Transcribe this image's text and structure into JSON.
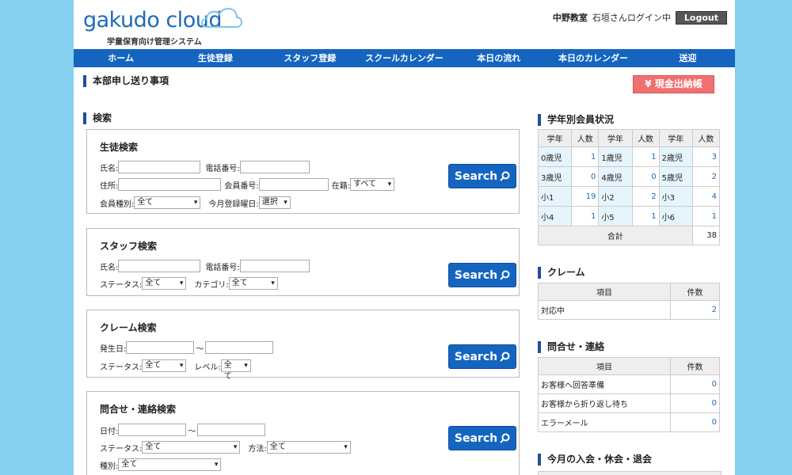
{
  "header": {
    "logo_text": "gakudo cloud",
    "logo_sub": "学童保育向け管理システム",
    "classroom": "中野教室",
    "login_info": "石垣さんログイン中",
    "logout_label": "Logout"
  },
  "nav": [
    "ホーム",
    "生徒登録",
    "スタッフ登録",
    "スクールカレンダー",
    "本日の流れ",
    "本日のカレンダー",
    "送迎"
  ],
  "notice_title": "本部申し送り事項",
  "cash_button": "¥ 現金出納帳",
  "search_title": "検索",
  "search_button": "Search",
  "student_search": {
    "title": "生徒検索",
    "name": "氏名:",
    "phone": "電話番号:",
    "address": "住所:",
    "member_no": "会員番号:",
    "enrolled": "在籍:",
    "enrolled_value": "すべて",
    "member_type": "会員種別:",
    "member_type_value": "全て",
    "reg_day": "今月登録曜日:",
    "reg_day_value": "選択"
  },
  "staff_search": {
    "title": "スタッフ検索",
    "name": "氏名:",
    "phone": "電話番号:",
    "status": "ステータス:",
    "status_value": "全て",
    "category": "カテゴリ:",
    "category_value": "全て"
  },
  "claim_search": {
    "title": "クレーム検索",
    "date": "発生日:",
    "tilde": "～",
    "status": "ステータス:",
    "status_value": "全て",
    "level": "レベル:",
    "level_value": "全て"
  },
  "inquiry_search": {
    "title": "問合せ・連絡検索",
    "date": "日付:",
    "tilde": "～",
    "status": "ステータス:",
    "status_value": "全て",
    "method": "方法:",
    "method_value": "全て",
    "type": "種別:",
    "type_value": "全て"
  },
  "grade_status": {
    "title": "学年別会員状況",
    "head_grade": "学年",
    "head_count": "人数",
    "rows": [
      [
        {
          "g": "0歳児",
          "n": "1"
        },
        {
          "g": "1歳児",
          "n": "1"
        },
        {
          "g": "2歳児",
          "n": "3"
        }
      ],
      [
        {
          "g": "3歳児",
          "n": "0"
        },
        {
          "g": "4歳児",
          "n": "0"
        },
        {
          "g": "5歳児",
          "n": "2"
        }
      ],
      [
        {
          "g": "小1",
          "n": "19"
        },
        {
          "g": "小2",
          "n": "2"
        },
        {
          "g": "小3",
          "n": "4"
        }
      ],
      [
        {
          "g": "小4",
          "n": "1"
        },
        {
          "g": "小5",
          "n": "1"
        },
        {
          "g": "小6",
          "n": "1"
        }
      ]
    ],
    "total_label": "合計",
    "total_value": "38"
  },
  "claim": {
    "title": "クレーム",
    "head_item": "項目",
    "head_count": "件数",
    "rows": [
      {
        "item": "対応中",
        "count": "2"
      }
    ]
  },
  "inquiry": {
    "title": "問合せ・連絡",
    "head_item": "項目",
    "head_count": "件数",
    "rows": [
      {
        "item": "お客様へ回答準備",
        "count": "0"
      },
      {
        "item": "お客様から折り返し待ち",
        "count": "0"
      },
      {
        "item": "エラーメール",
        "count": "0"
      }
    ]
  },
  "monthly_title": "今月の入会・休会・退会"
}
